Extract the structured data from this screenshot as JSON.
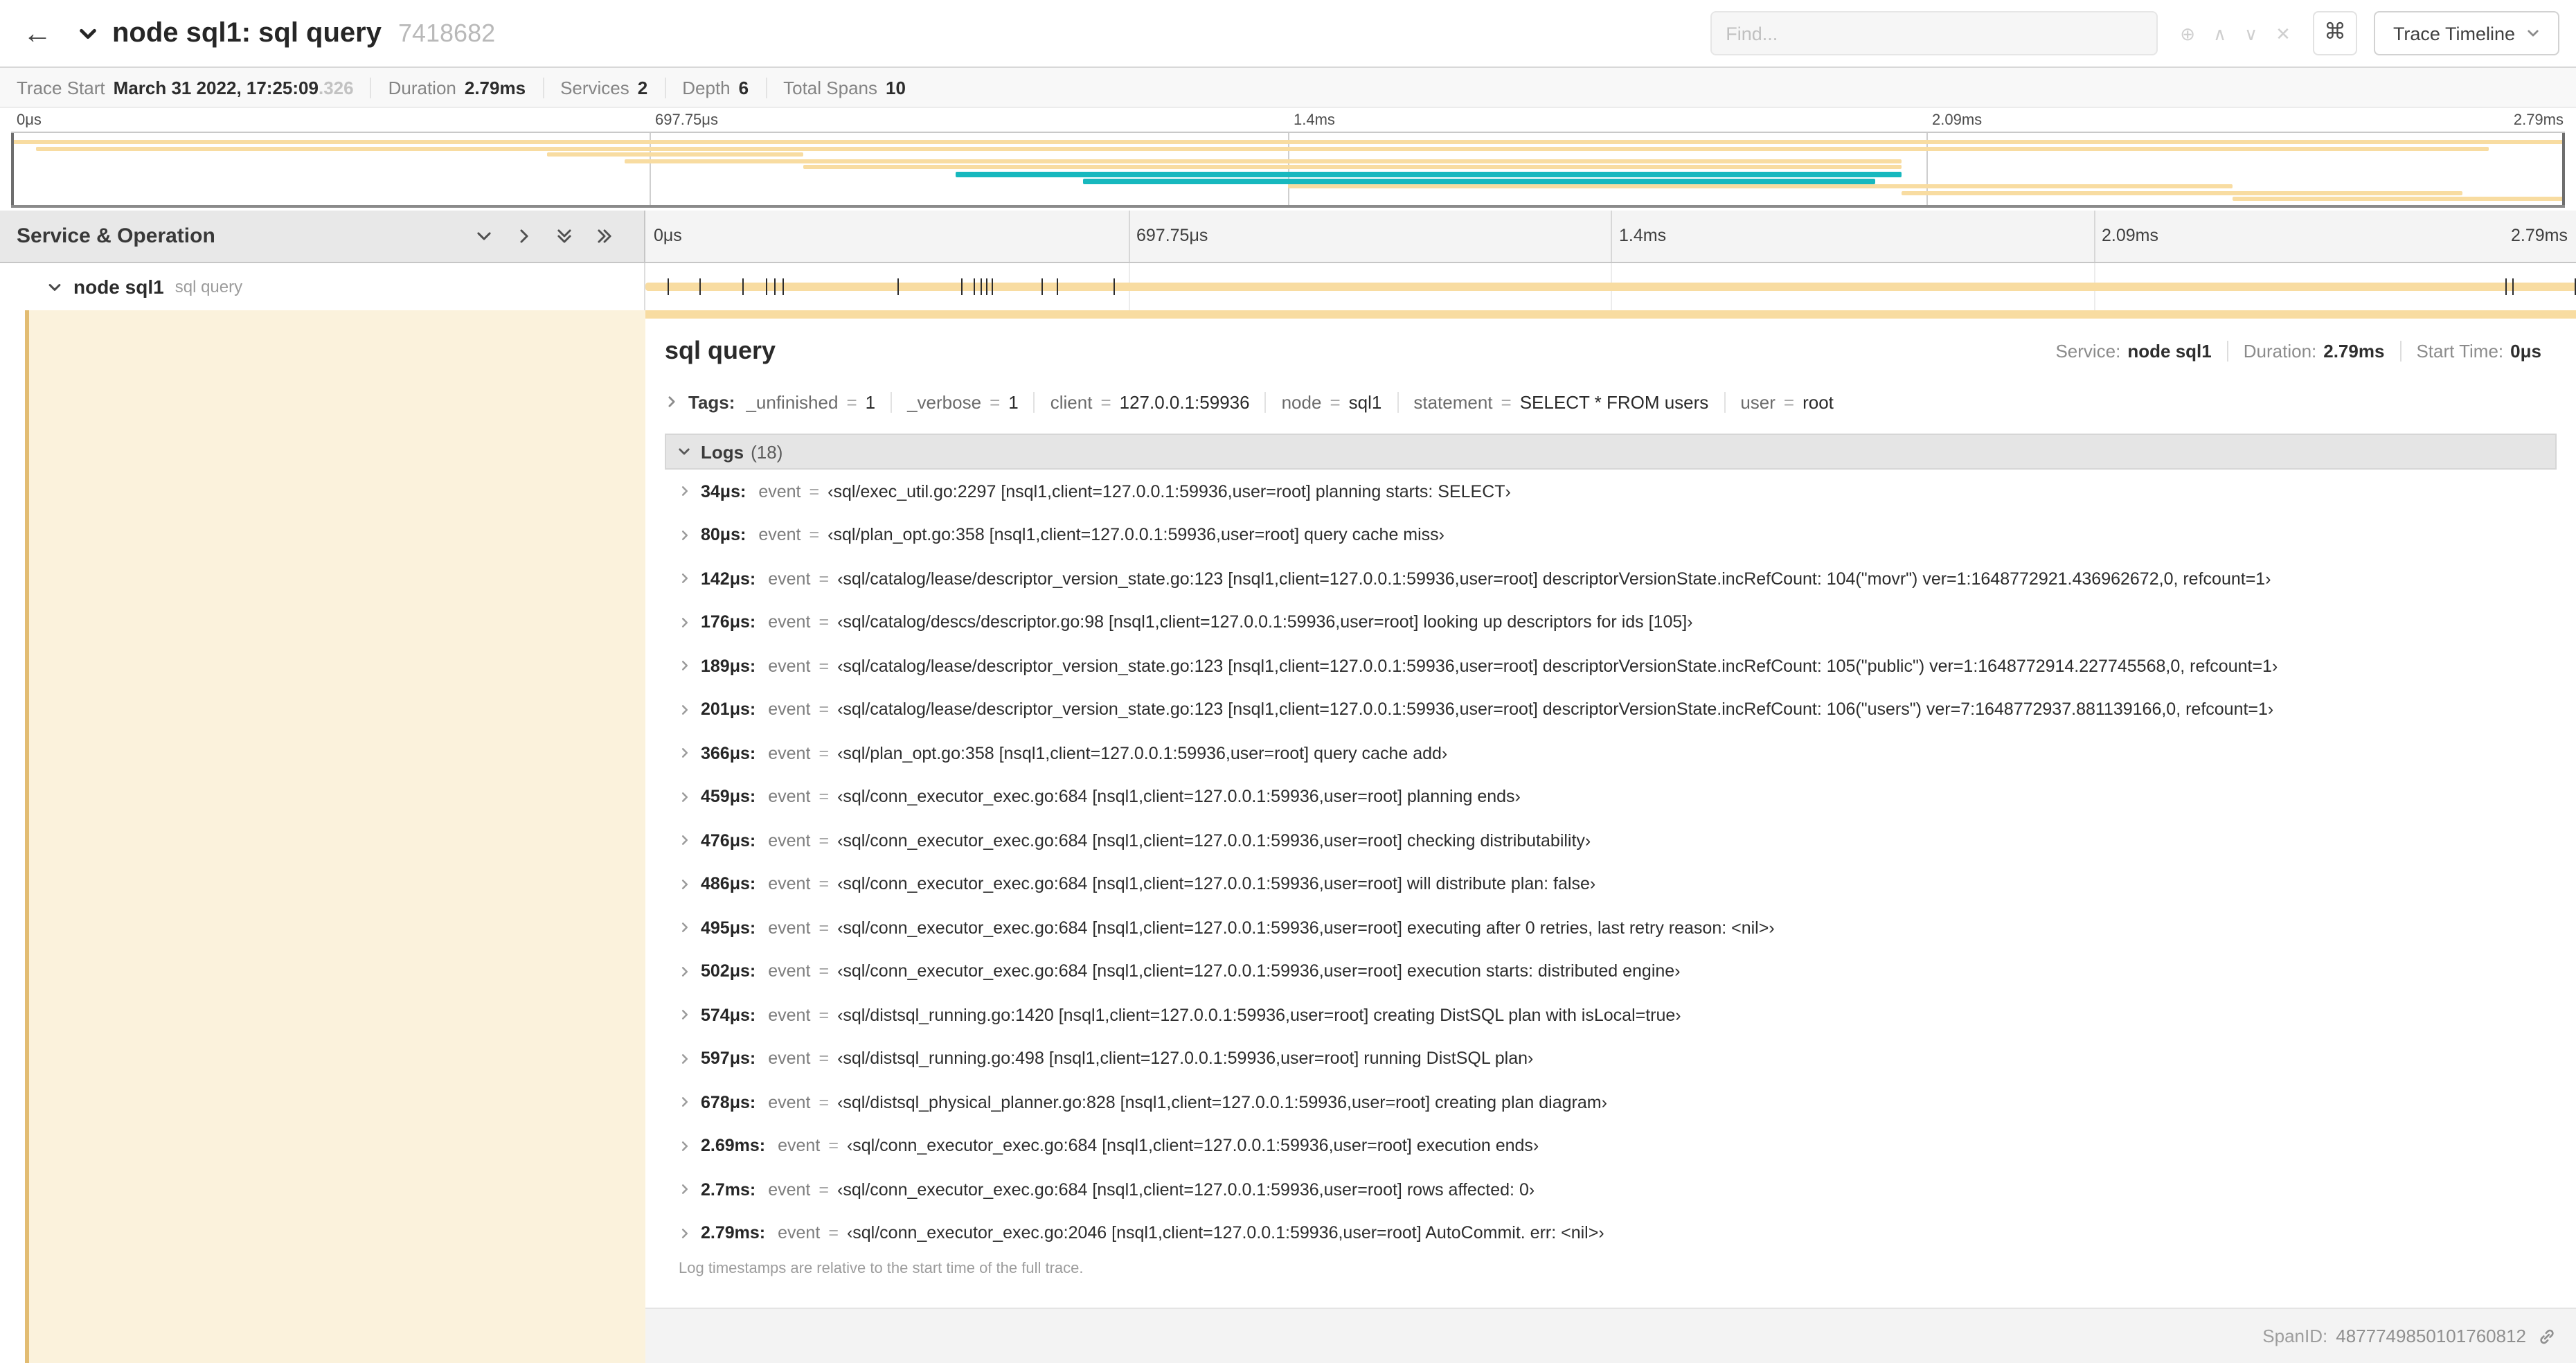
{
  "header": {
    "title": "node sql1: sql query",
    "trace_id": "7418682",
    "find": {
      "placeholder": "Find..."
    },
    "icons": {
      "circle_plus": "⊕",
      "chevron_up": "∧",
      "chevron_down": "∨",
      "clear": "✕",
      "command": "⌘"
    },
    "view_select": {
      "label": "Trace Timeline"
    }
  },
  "glyphs": {
    "equals": "="
  },
  "trace_info": {
    "items": [
      {
        "label": "Trace Start",
        "value": "March 31 2022, 17:25:09",
        "suffix": ".326"
      },
      {
        "label": "Duration",
        "value": "2.79ms"
      },
      {
        "label": "Services",
        "value": "2"
      },
      {
        "label": "Depth",
        "value": "6"
      },
      {
        "label": "Total Spans",
        "value": "10"
      }
    ]
  },
  "timeline": {
    "duration_us": 2790,
    "ticks": [
      "0μs",
      "697.75μs",
      "1.4ms",
      "2.09ms",
      "2.79ms"
    ],
    "colors": {
      "tan": "#F8DCA1",
      "teal": "#17B8BE"
    },
    "minimap_bars": [
      {
        "row": 0,
        "start_pct": 0,
        "end_pct": 100,
        "color": "tan"
      },
      {
        "row": 1,
        "start_pct": 1,
        "end_pct": 97,
        "color": "tan"
      },
      {
        "row": 2,
        "start_pct": 21,
        "end_pct": 31,
        "color": "tan"
      },
      {
        "row": 3,
        "start_pct": 24,
        "end_pct": 74,
        "color": "tan"
      },
      {
        "row": 4,
        "start_pct": 31,
        "end_pct": 74,
        "color": "tan"
      },
      {
        "row": 5,
        "start_pct": 37,
        "end_pct": 74,
        "color": "teal"
      },
      {
        "row": 6,
        "start_pct": 42,
        "end_pct": 73,
        "color": "teal"
      },
      {
        "row": 7,
        "start_pct": 50,
        "end_pct": 87,
        "color": "tan"
      },
      {
        "row": 8,
        "start_pct": 74,
        "end_pct": 96,
        "color": "tan"
      },
      {
        "row": 9,
        "start_pct": 87,
        "end_pct": 100,
        "color": "tan"
      }
    ],
    "log_marks_us": [
      34,
      80,
      142,
      176,
      189,
      201,
      366,
      459,
      476,
      486,
      495,
      502,
      574,
      597,
      678,
      2690,
      2700,
      2790
    ]
  },
  "left_panel": {
    "header": "Service & Operation"
  },
  "span_row": {
    "service": "node sql1",
    "operation": "sql query"
  },
  "detail": {
    "title": "sql query",
    "stats": [
      {
        "label": "Service:",
        "value": "node sql1"
      },
      {
        "label": "Duration:",
        "value": "2.79ms"
      },
      {
        "label": "Start Time:",
        "value": "0μs"
      }
    ],
    "tags": {
      "label": "Tags:",
      "items": [
        {
          "key": "_unfinished",
          "value": "1"
        },
        {
          "key": "_verbose",
          "value": "1"
        },
        {
          "key": "client",
          "value": "127.0.0.1:59936"
        },
        {
          "key": "node",
          "value": "sql1"
        },
        {
          "key": "statement",
          "value": "SELECT * FROM users"
        },
        {
          "key": "user",
          "value": "root"
        }
      ]
    },
    "logs": {
      "label": "Logs",
      "count": "(18)",
      "entries": [
        {
          "time": "34μs:",
          "key": "event",
          "value": "‹sql/exec_util.go:2297 [nsql1,client=127.0.0.1:59936,user=root] planning starts: SELECT›"
        },
        {
          "time": "80μs:",
          "key": "event",
          "value": "‹sql/plan_opt.go:358 [nsql1,client=127.0.0.1:59936,user=root] query cache miss›"
        },
        {
          "time": "142μs:",
          "key": "event",
          "value": "‹sql/catalog/lease/descriptor_version_state.go:123 [nsql1,client=127.0.0.1:59936,user=root] descriptorVersionState.incRefCount: 104(\"movr\") ver=1:1648772921.436962672,0, refcount=1›"
        },
        {
          "time": "176μs:",
          "key": "event",
          "value": "‹sql/catalog/descs/descriptor.go:98 [nsql1,client=127.0.0.1:59936,user=root] looking up descriptors for ids [105]›"
        },
        {
          "time": "189μs:",
          "key": "event",
          "value": "‹sql/catalog/lease/descriptor_version_state.go:123 [nsql1,client=127.0.0.1:59936,user=root] descriptorVersionState.incRefCount: 105(\"public\") ver=1:1648772914.227745568,0, refcount=1›"
        },
        {
          "time": "201μs:",
          "key": "event",
          "value": "‹sql/catalog/lease/descriptor_version_state.go:123 [nsql1,client=127.0.0.1:59936,user=root] descriptorVersionState.incRefCount: 106(\"users\") ver=7:1648772937.881139166,0, refcount=1›"
        },
        {
          "time": "366μs:",
          "key": "event",
          "value": "‹sql/plan_opt.go:358 [nsql1,client=127.0.0.1:59936,user=root] query cache add›"
        },
        {
          "time": "459μs:",
          "key": "event",
          "value": "‹sql/conn_executor_exec.go:684 [nsql1,client=127.0.0.1:59936,user=root] planning ends›"
        },
        {
          "time": "476μs:",
          "key": "event",
          "value": "‹sql/conn_executor_exec.go:684 [nsql1,client=127.0.0.1:59936,user=root] checking distributability›"
        },
        {
          "time": "486μs:",
          "key": "event",
          "value": "‹sql/conn_executor_exec.go:684 [nsql1,client=127.0.0.1:59936,user=root] will distribute plan: false›"
        },
        {
          "time": "495μs:",
          "key": "event",
          "value": "‹sql/conn_executor_exec.go:684 [nsql1,client=127.0.0.1:59936,user=root] executing after 0 retries, last retry reason: <nil>›"
        },
        {
          "time": "502μs:",
          "key": "event",
          "value": "‹sql/conn_executor_exec.go:684 [nsql1,client=127.0.0.1:59936,user=root] execution starts: distributed engine›"
        },
        {
          "time": "574μs:",
          "key": "event",
          "value": "‹sql/distsql_running.go:1420 [nsql1,client=127.0.0.1:59936,user=root] creating DistSQL plan with isLocal=true›"
        },
        {
          "time": "597μs:",
          "key": "event",
          "value": "‹sql/distsql_running.go:498 [nsql1,client=127.0.0.1:59936,user=root] running DistSQL plan›"
        },
        {
          "time": "678μs:",
          "key": "event",
          "value": "‹sql/distsql_physical_planner.go:828 [nsql1,client=127.0.0.1:59936,user=root] creating plan diagram›"
        },
        {
          "time": "2.69ms:",
          "key": "event",
          "value": "‹sql/conn_executor_exec.go:684 [nsql1,client=127.0.0.1:59936,user=root] execution ends›"
        },
        {
          "time": "2.7ms:",
          "key": "event",
          "value": "‹sql/conn_executor_exec.go:684 [nsql1,client=127.0.0.1:59936,user=root] rows affected: 0›"
        },
        {
          "time": "2.79ms:",
          "key": "event",
          "value": "‹sql/conn_executor_exec.go:2046 [nsql1,client=127.0.0.1:59936,user=root] AutoCommit. err: <nil>›"
        }
      ],
      "footer": "Log timestamps are relative to the start time of the full trace."
    },
    "span_id": {
      "label": "SpanID:",
      "value": "4877749850101760812"
    }
  }
}
